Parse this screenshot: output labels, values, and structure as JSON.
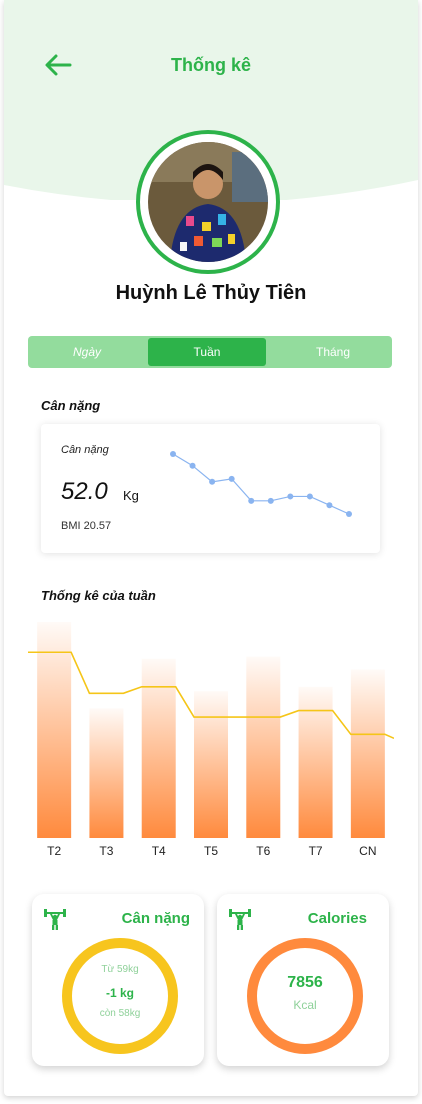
{
  "header": {
    "title": "Thống kê",
    "back_icon": "arrow-left-icon"
  },
  "profile": {
    "name": "Huỳnh Lê Thủy Tiên"
  },
  "tabs": [
    {
      "label": "Ngày",
      "active": false
    },
    {
      "label": "Tuần",
      "active": true
    },
    {
      "label": "Tháng",
      "active": false
    }
  ],
  "weight_section": {
    "label": "Cân nặng",
    "card_label": "Cân nặng",
    "value": "52.0",
    "unit": "Kg",
    "bmi": "BMI 20.57"
  },
  "weight_sparkline": [
    5.0,
    4.2,
    3.1,
    3.3,
    1.8,
    1.8,
    2.1,
    2.1,
    1.5,
    0.9
  ],
  "week_section": {
    "label": "Thống kê của tuần"
  },
  "chart_data": {
    "type": "bar",
    "categories": [
      "T2",
      "T3",
      "T4",
      "T5",
      "T6",
      "T7",
      "CN"
    ],
    "series": [
      {
        "type": "bar",
        "values": [
          100,
          60,
          83,
          68,
          84,
          70,
          78
        ]
      },
      {
        "type": "line",
        "values": [
          86,
          67,
          70,
          56,
          56,
          59,
          48
        ]
      }
    ],
    "ylim": [
      0,
      100
    ]
  },
  "cards": {
    "weight": {
      "title": "Cân nặng",
      "icon": "weightlifter-icon",
      "from": "Từ 59kg",
      "delta": "-1 kg",
      "remaining": "còn 58kg"
    },
    "calories": {
      "title": "Calories",
      "icon": "weightlifter-icon",
      "value": "7856",
      "unit": "Kcal"
    }
  },
  "colors": {
    "accent": "#2db34a",
    "tab_bg": "#93dc9d",
    "hero_bg": "#e9f6ea",
    "bar": "#ff8a3d",
    "line": "#f5c518",
    "ring_weight": "#f7c51e",
    "ring_calories": "#ff8a3d",
    "spark": "#8ab4f0"
  }
}
